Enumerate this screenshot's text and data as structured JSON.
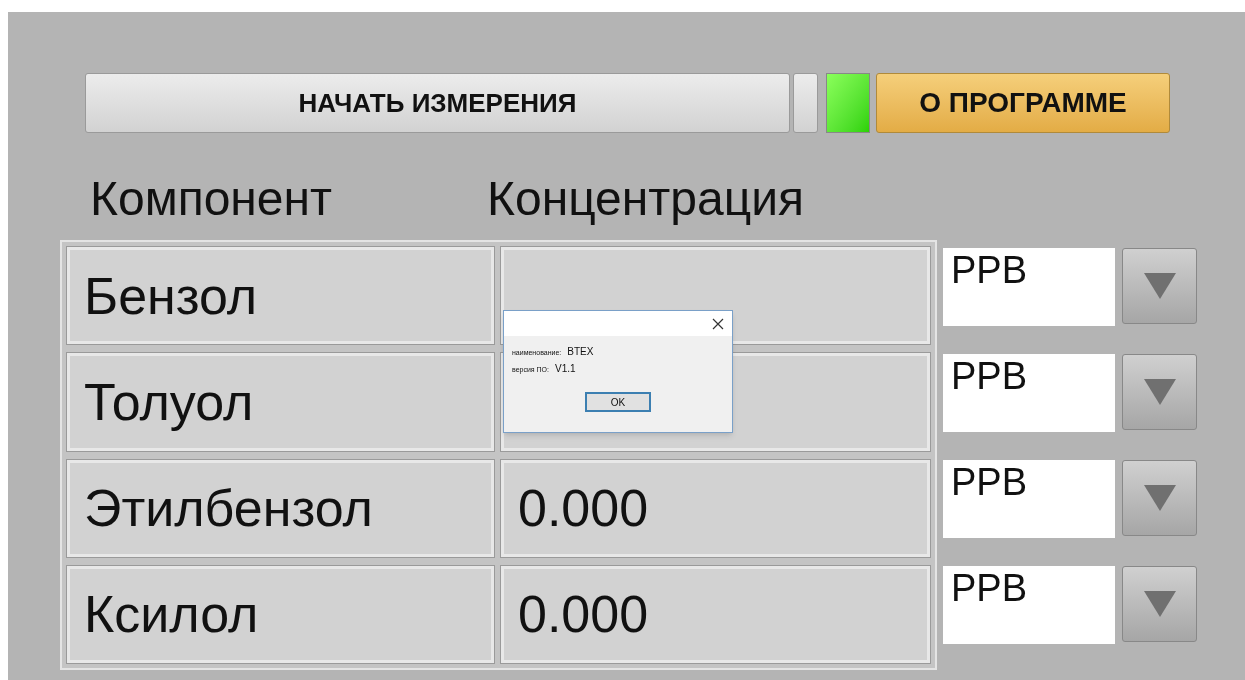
{
  "toolbar": {
    "start_button": "НАЧАТЬ ИЗМЕРЕНИЯ",
    "indicator": {
      "on": true
    },
    "about_button": "О ПРОГРАММЕ"
  },
  "headers": [
    "Компонент",
    "Концентрация"
  ],
  "rows": [
    {
      "name": "Бензол",
      "unit": "PPB"
    },
    {
      "name": "Толуол",
      "unit": "PPB"
    },
    {
      "name": "Этилбензол",
      "value": "0.000",
      "unit": "PPB"
    },
    {
      "name": "Ксилол",
      "value": "0.000",
      "unit": "PPB"
    }
  ],
  "dialog": {
    "lines": [
      {
        "label": "наименование:",
        "value": "BTEX"
      },
      {
        "label": "версия ПО:",
        "value": "V1.1"
      }
    ],
    "ok_button": "OK"
  }
}
